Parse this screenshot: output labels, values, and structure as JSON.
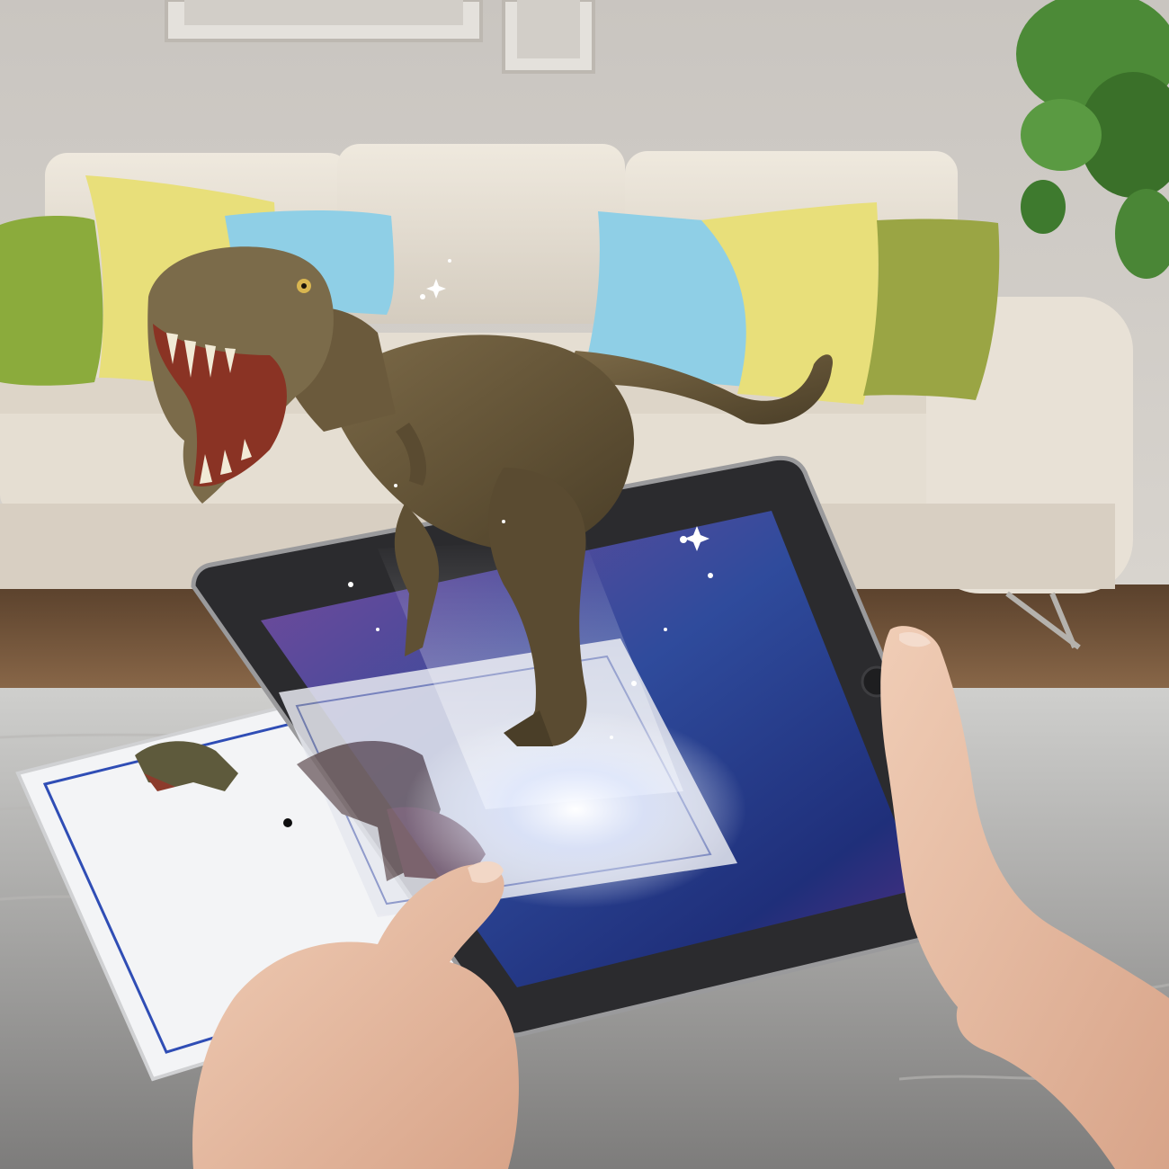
{
  "scene": {
    "kind": "augmented-reality-dinosaur-photo",
    "subject": "t-rex",
    "objects": [
      "wall",
      "picture-frame",
      "sofa",
      "cushions",
      "plant",
      "floor",
      "table",
      "dinosaur-card",
      "tablet",
      "hands",
      "sparkles"
    ]
  },
  "colors": {
    "wall": "#d3cfca",
    "sofa": "#e7e0d4",
    "cushion_green": "#8bab3c",
    "cushion_yellow": "#e8df7a",
    "cushion_blue": "#8fcfe6",
    "cushion_olive": "#9aa544",
    "floor_wood": "#7a5a3e",
    "table": "#c9c8c6",
    "tablet_bezel": "#2b2b2e",
    "screen_top": "#6b3e88",
    "screen_mid": "#2e3f8c",
    "screen_bottom": "#53307e",
    "dino": "#6f5d3e",
    "skin": "#e3b9a0",
    "card_border": "#2f4db5"
  }
}
